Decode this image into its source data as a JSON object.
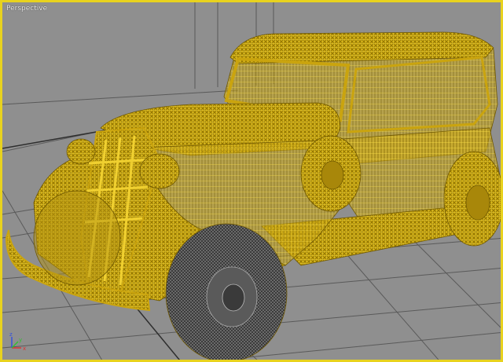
{
  "viewport": {
    "label": "Perspective",
    "active_border_color": "#e8d21e",
    "background_color": "#8c8c8c"
  },
  "model": {
    "description": "vintage car wireframe",
    "wire_color": "#d9b412",
    "tire_wire_color": "#4a4a4a"
  },
  "gizmo": {
    "x_label": "x",
    "y_label": "y",
    "z_label": "z"
  }
}
